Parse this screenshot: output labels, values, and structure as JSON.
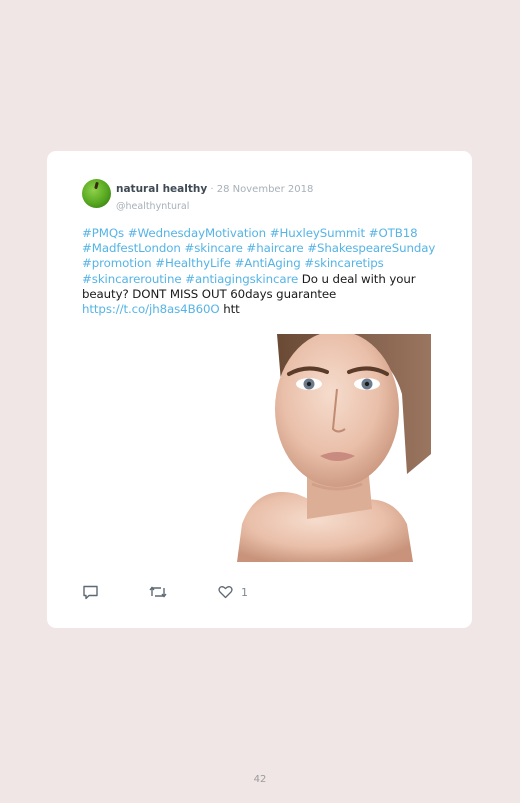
{
  "tweet": {
    "author_name": "natural healthy",
    "separator": " · ",
    "date": "28 November 2018",
    "handle": "@healthyntural",
    "hashtags": [
      "#PMQs",
      "#WednesdayMotivation",
      "#HuxleySummit",
      "#OTB18",
      "#MadfestLondon",
      "#skincare",
      "#haircare",
      "#ShakespeareSunday",
      "#promotion",
      "#HealthyLife",
      "#AntiAging",
      "#skincaretips",
      "#skincareroutine",
      "#antiagingskincare"
    ],
    "body_text": "Do u deal with your beauty? DONT MISS OUT 60days guarantee",
    "link": "https://t.co/jh8as4B60O",
    "trailing_text": "htt",
    "like_count": "1"
  },
  "icons": {
    "reply": "comment-icon",
    "retweet": "retweet-icon",
    "like": "heart-icon",
    "avatar": "green-apple-avatar"
  },
  "colors": {
    "page_background": "#efe6e5",
    "card_background": "#ffffff",
    "hashtag": "#55b4e6",
    "meta_text": "#a7b0b8"
  },
  "page": {
    "number": "42"
  }
}
